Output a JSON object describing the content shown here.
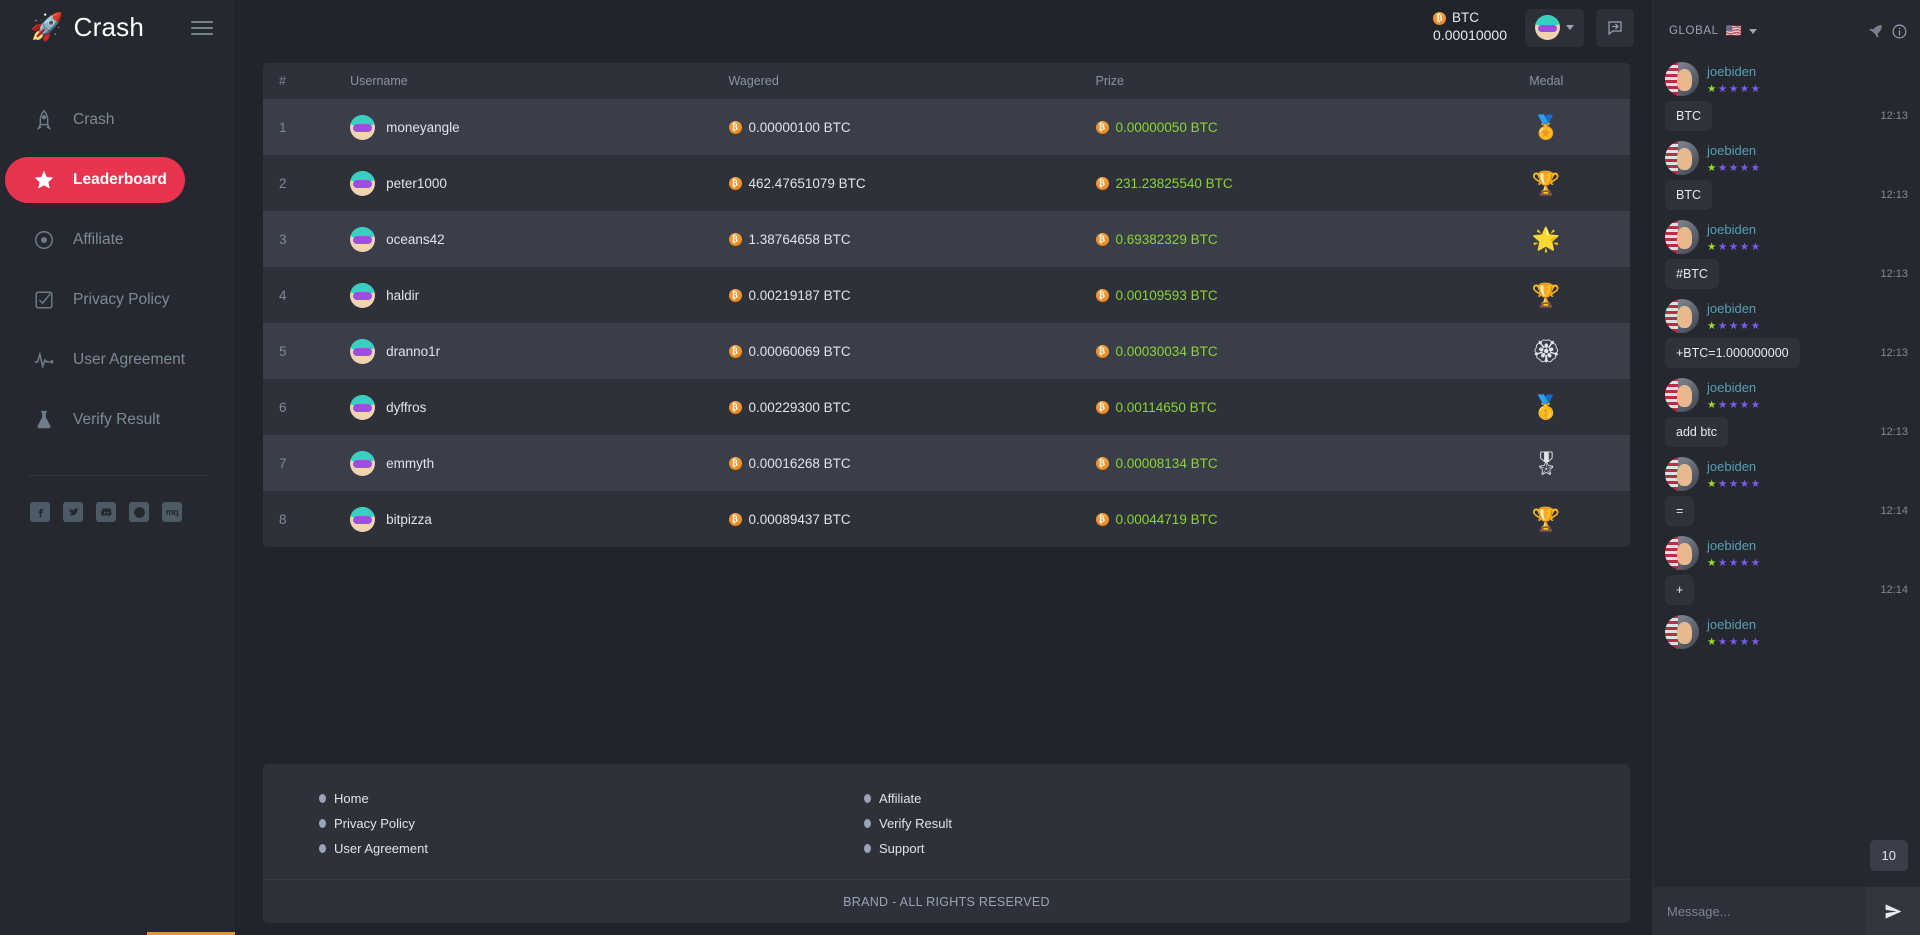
{
  "brand": {
    "logo_icon": "rocket-icon",
    "name": "Crash"
  },
  "sidebar": {
    "items": [
      {
        "label": "Crash",
        "icon": "rocket-outline-icon",
        "active": false
      },
      {
        "label": "Leaderboard",
        "icon": "star-icon",
        "active": true
      },
      {
        "label": "Affiliate",
        "icon": "target-icon",
        "active": false
      },
      {
        "label": "Privacy Policy",
        "icon": "checkbox-icon",
        "active": false
      },
      {
        "label": "User Agreement",
        "icon": "pulse-icon",
        "active": false
      },
      {
        "label": "Verify Result",
        "icon": "flask-icon",
        "active": false
      }
    ],
    "socials": [
      {
        "name": "facebook-icon",
        "glyph": "f"
      },
      {
        "name": "twitter-icon",
        "glyph": "t"
      },
      {
        "name": "discord-icon",
        "glyph": "d"
      },
      {
        "name": "dribbble-icon",
        "glyph": "b"
      },
      {
        "name": "mq-icon",
        "glyph": "mq"
      }
    ]
  },
  "topbar": {
    "currency": "BTC",
    "balance": "0.00010000",
    "coin_icon": "bitcoin-icon",
    "avatar_icon": "user-avatar",
    "chevron_icon": "chevron-down-icon",
    "bell_icon": "bell-icon",
    "chat_toggle_icon": "chat-toggle-icon"
  },
  "leaderboard": {
    "columns": [
      "#",
      "Username",
      "Wagered",
      "Prize",
      "Medal"
    ],
    "rows": [
      {
        "rank": "1",
        "username": "moneyangle",
        "wagered": "0.00000100 BTC",
        "prize": "0.00000050 BTC",
        "medal": "🏅"
      },
      {
        "rank": "2",
        "username": "peter1000",
        "wagered": "462.47651079 BTC",
        "prize": "231.23825540 BTC",
        "medal": "🏆"
      },
      {
        "rank": "3",
        "username": "oceans42",
        "wagered": "1.38764658 BTC",
        "prize": "0.69382329 BTC",
        "medal": "🌟"
      },
      {
        "rank": "4",
        "username": "haldir",
        "wagered": "0.00219187 BTC",
        "prize": "0.00109593 BTC",
        "medal": "🏆"
      },
      {
        "rank": "5",
        "username": "dranno1r",
        "wagered": "0.00060069 BTC",
        "prize": "0.00030034 BTC",
        "medal": "🏵"
      },
      {
        "rank": "6",
        "username": "dyffros",
        "wagered": "0.00229300 BTC",
        "prize": "0.00114650 BTC",
        "medal": "🥇"
      },
      {
        "rank": "7",
        "username": "emmyth",
        "wagered": "0.00016268 BTC",
        "prize": "0.00008134 BTC",
        "medal": "🎖"
      },
      {
        "rank": "8",
        "username": "bitpizza",
        "wagered": "0.00089437 BTC",
        "prize": "0.00044719 BTC",
        "medal": "🏆"
      }
    ]
  },
  "footer": {
    "left_links": [
      "Home",
      "Privacy Policy",
      "User Agreement"
    ],
    "right_links": [
      "Affiliate",
      "Verify Result",
      "Support"
    ],
    "copyright": "BRAND - ALL RIGHTS RESERVED"
  },
  "chat": {
    "scope": "GLOBAL",
    "flag": "🇺🇸",
    "chevron_icon": "chevron-down-icon",
    "rocket_icon": "rocket-icon",
    "info_icon": "info-icon",
    "unread_count": "10",
    "input_placeholder": "Message...",
    "send_icon": "send-icon",
    "messages": [
      {
        "user": "joebiden",
        "stars_on": 1,
        "stars_total": 5,
        "text": "BTC",
        "time": "12:13"
      },
      {
        "user": "joebiden",
        "stars_on": 1,
        "stars_total": 5,
        "text": "BTC",
        "time": "12:13"
      },
      {
        "user": "joebiden",
        "stars_on": 1,
        "stars_total": 5,
        "text": "#BTC",
        "time": "12:13"
      },
      {
        "user": "joebiden",
        "stars_on": 1,
        "stars_total": 5,
        "text": "+BTC=1.000000000",
        "time": "12:13"
      },
      {
        "user": "joebiden",
        "stars_on": 1,
        "stars_total": 5,
        "text": "add btc",
        "time": "12:13"
      },
      {
        "user": "joebiden",
        "stars_on": 1,
        "stars_total": 5,
        "text": "=",
        "time": "12:14"
      },
      {
        "user": "joebiden",
        "stars_on": 1,
        "stars_total": 5,
        "text": "+",
        "time": "12:14"
      },
      {
        "user": "joebiden",
        "stars_on": 1,
        "stars_total": 5,
        "text": "",
        "time": ""
      }
    ]
  },
  "colors": {
    "accent_red": "#e8344e",
    "prize_green": "#8bd62e",
    "bg_dark": "#22242b",
    "panel": "#2e313a",
    "row_alt": "#3a3e49",
    "chat_user": "#56a0b5"
  }
}
